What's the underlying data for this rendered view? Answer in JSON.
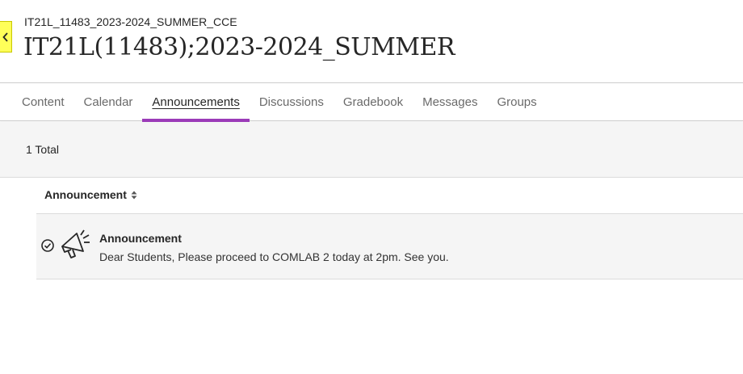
{
  "course": {
    "code": "IT21L_11483_2023-2024_SUMMER_CCE",
    "title": "IT21L(11483);2023-2024_SUMMER",
    "back_icon": "chevron-left-icon"
  },
  "tabs": [
    {
      "label": "Content",
      "active": false
    },
    {
      "label": "Calendar",
      "active": false
    },
    {
      "label": "Announcements",
      "active": true
    },
    {
      "label": "Discussions",
      "active": false
    },
    {
      "label": "Gradebook",
      "active": false
    },
    {
      "label": "Messages",
      "active": false
    },
    {
      "label": "Groups",
      "active": false
    }
  ],
  "summary": {
    "total_label": "1 Total"
  },
  "list": {
    "column_header": "Announcement",
    "sort_icon": "sort-icon",
    "items": [
      {
        "status_icon": "check-circle-icon",
        "type_icon": "megaphone-icon",
        "title": "Announcement",
        "body": "Dear Students, Please proceed to COMLAB 2 today at 2pm. See you."
      }
    ]
  },
  "colors": {
    "accent": "#9b3bb8",
    "back_tab": "#ffff59",
    "row_bg": "#f5f5f5"
  }
}
